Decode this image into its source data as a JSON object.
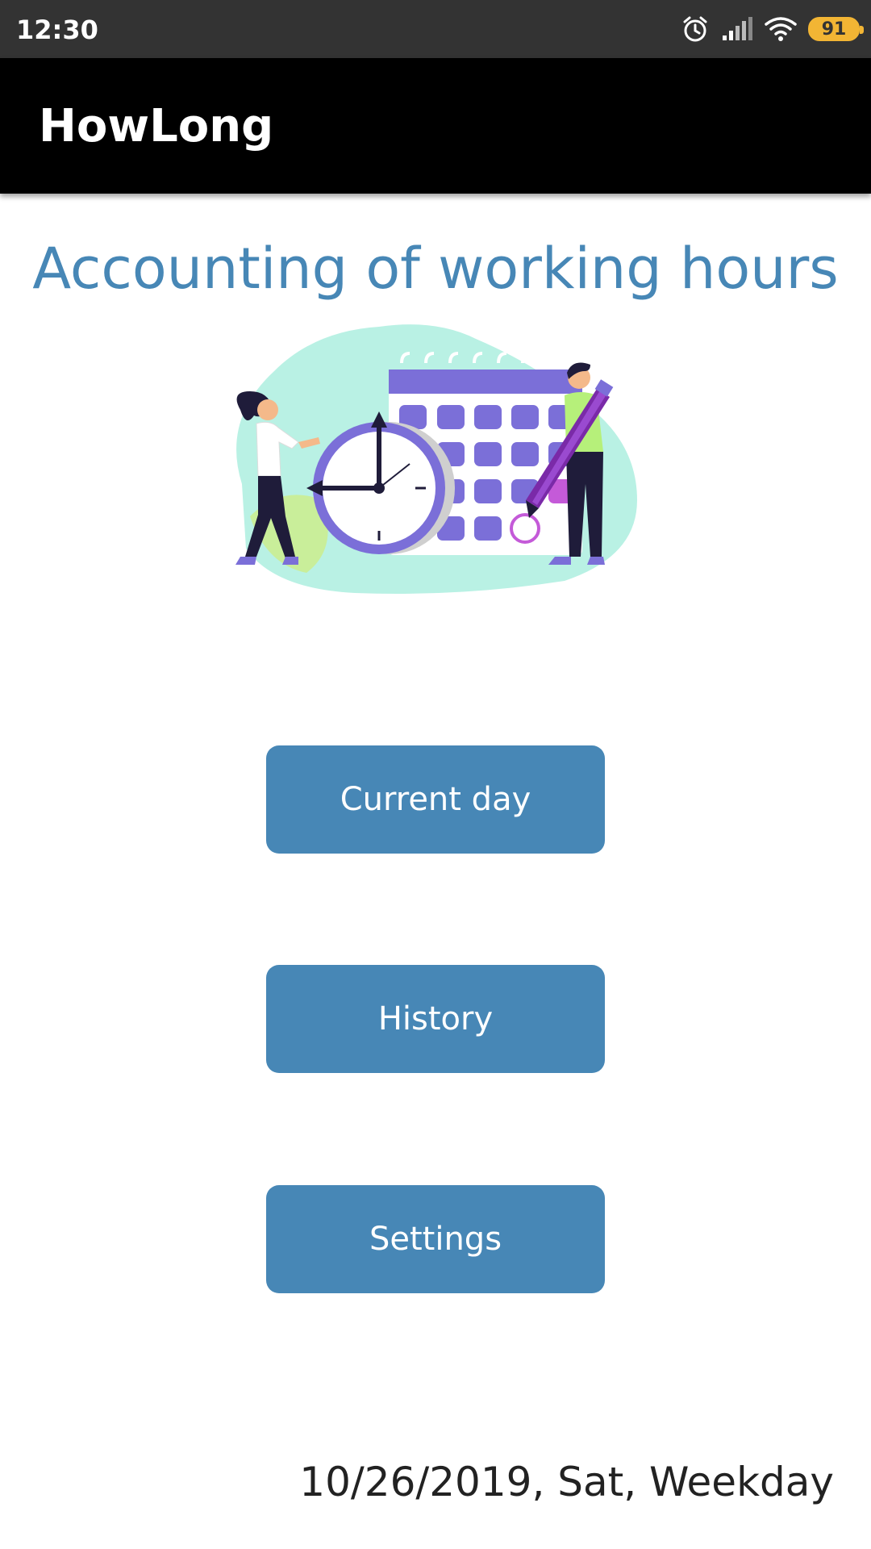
{
  "status_bar": {
    "time": "12:30",
    "battery_level": "91",
    "icons": [
      "alarm-icon",
      "signal-icon",
      "wifi-icon",
      "battery-icon"
    ]
  },
  "app_bar": {
    "title": "HowLong"
  },
  "main": {
    "headline": "Accounting of working hours",
    "illustration": "calendar-clock-people-illustration",
    "buttons": {
      "current_day": "Current day",
      "history": "History",
      "settings": "Settings"
    }
  },
  "footer": {
    "date": "10/26/2019, Sat, Weekday"
  },
  "colors": {
    "accent": "#4787b6",
    "app_bar": "#000000",
    "status_bar": "#333333",
    "calendar": "#7b6fd8",
    "illustration_bg": "#b9f1e4"
  }
}
